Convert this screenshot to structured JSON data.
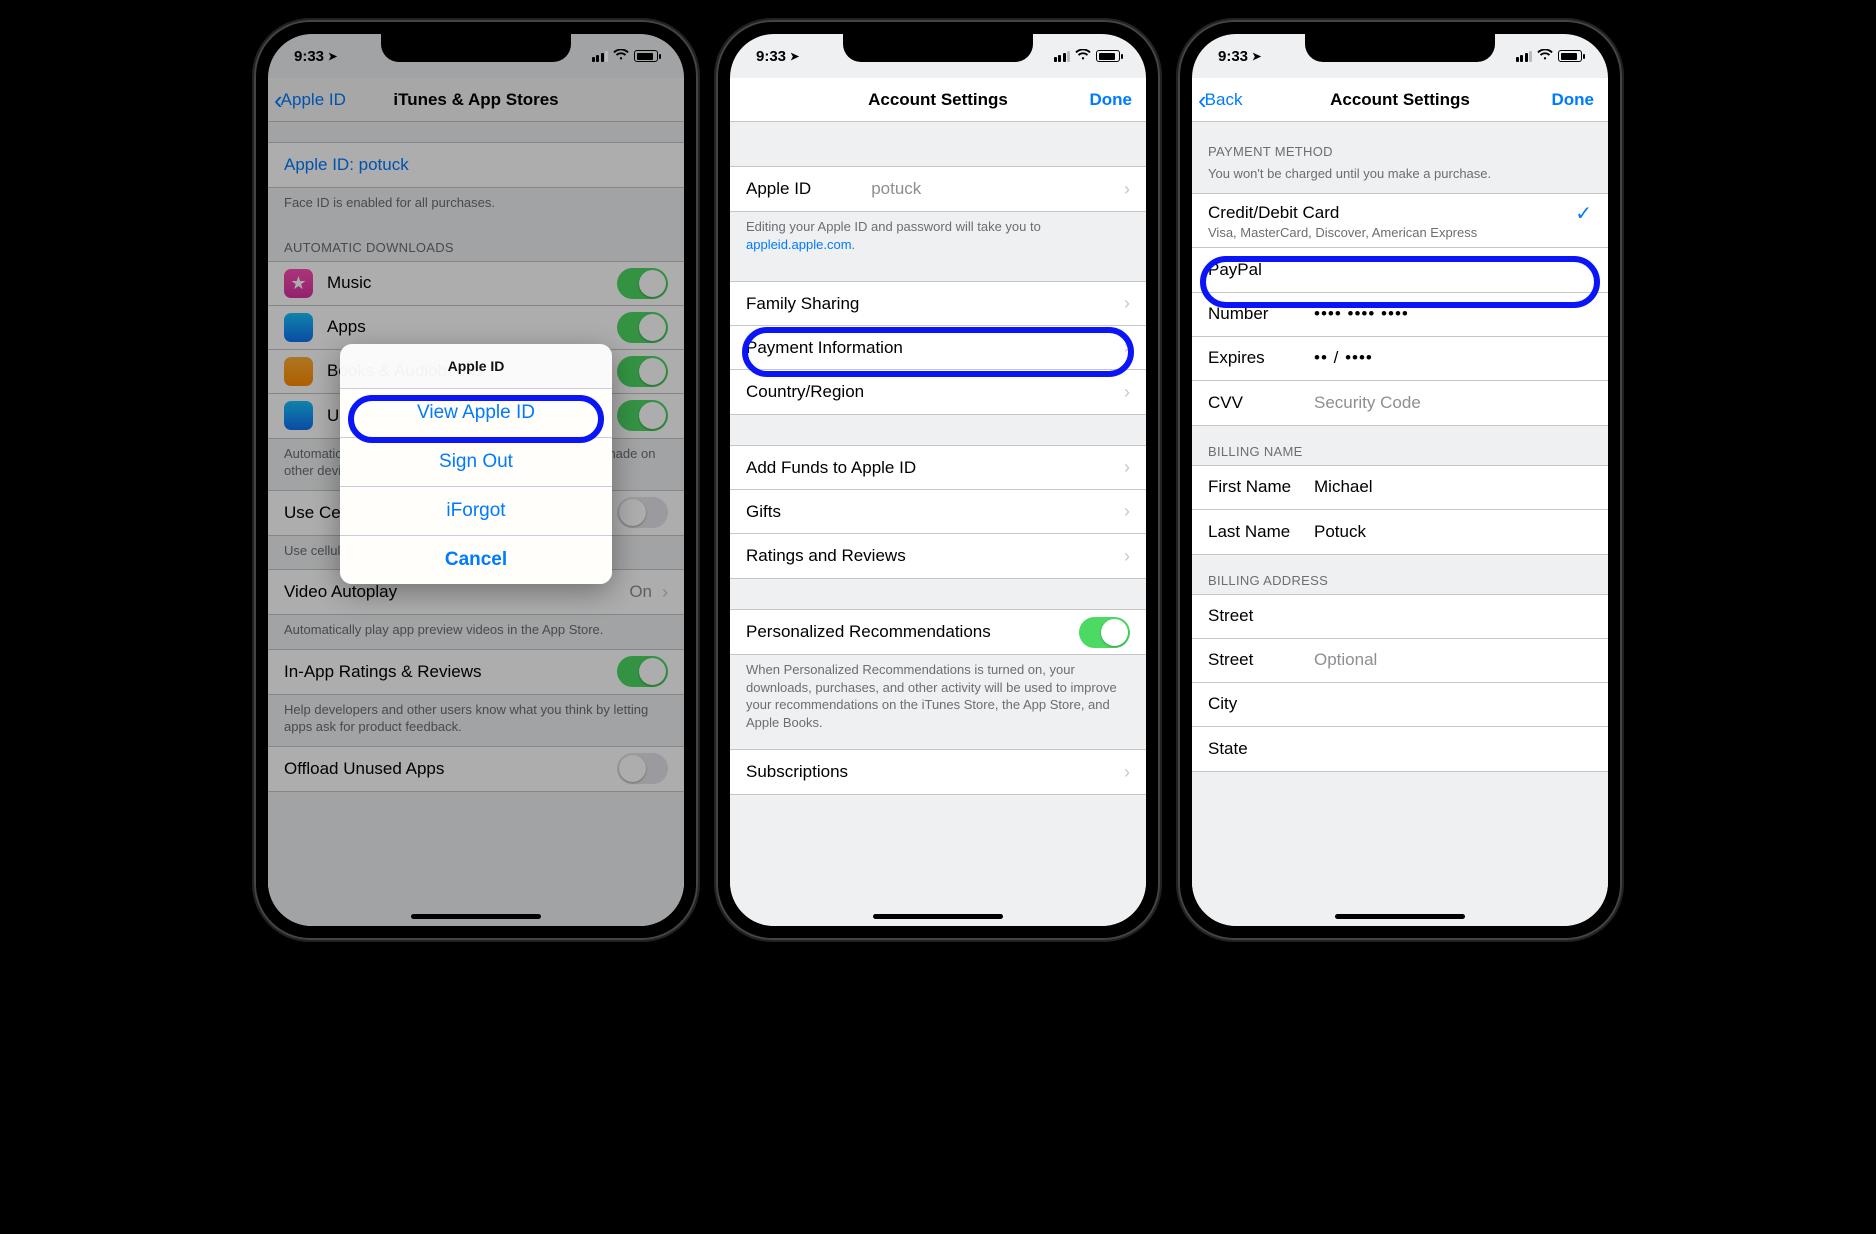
{
  "status": {
    "time": "9:33",
    "loc_icon": "◤"
  },
  "phone1": {
    "nav_back": "Apple ID",
    "nav_title": "iTunes & App Stores",
    "apple_id_row": "Apple ID: potuck",
    "faceid_footer": "Face ID is enabled for all purchases.",
    "section_auto": "AUTOMATIC DOWNLOADS",
    "rows_auto": {
      "music": "Music",
      "apps": "Apps",
      "books": "Books & Audiobooks",
      "updates": "Updates"
    },
    "auto_footer": "Automatically download new purchases (including free) made on other devices.",
    "cellular_row": "Use Cellular Data",
    "cellular_footer": "Use cellular network for automatic downloads.",
    "video_row": "Video Autoplay",
    "video_value": "On",
    "video_footer": "Automatically play app preview videos in the App Store.",
    "inapp_row": "In-App Ratings & Reviews",
    "inapp_footer": "Help developers and other users know what you think by letting apps ask for product feedback.",
    "offload_row": "Offload Unused Apps",
    "sheet": {
      "title": "Apple ID",
      "view": "View Apple ID",
      "signout": "Sign Out",
      "iforgot": "iForgot",
      "cancel": "Cancel"
    }
  },
  "phone2": {
    "nav_title": "Account Settings",
    "nav_done": "Done",
    "appleid_label": "Apple ID",
    "appleid_value": "potuck",
    "appleid_footer_pre": "Editing your Apple ID and password will take you to ",
    "appleid_footer_link": "appleid.apple.com",
    "rows1": {
      "family": "Family Sharing",
      "payment": "Payment Information",
      "country": "Country/Region"
    },
    "rows2": {
      "addfunds": "Add Funds to Apple ID",
      "gifts": "Gifts",
      "ratings": "Ratings and Reviews"
    },
    "personal": "Personalized Recommendations",
    "personal_footer": "When Personalized Recommendations is turned on, your downloads, purchases, and other activity will be used to improve your recommendations on the iTunes Store, the App Store, and Apple Books.",
    "subs": "Subscriptions"
  },
  "phone3": {
    "nav_back": "Back",
    "nav_title": "Account Settings",
    "nav_done": "Done",
    "section_pm": "PAYMENT METHOD",
    "pm_footer": "You won't be charged until you make a purchase.",
    "credit_label": "Credit/Debit Card",
    "credit_sub": "Visa, MasterCard, Discover, American Express",
    "paypal": "PayPal",
    "number_label": "Number",
    "number_value": "•••• •••• ••••",
    "expires_label": "Expires",
    "expires_value": "••   /   ••••",
    "cvv_label": "CVV",
    "cvv_placeholder": "Security Code",
    "section_bn": "BILLING NAME",
    "fn_label": "First Name",
    "fn_value": "Michael",
    "ln_label": "Last Name",
    "ln_value": "Potuck",
    "section_ba": "BILLING ADDRESS",
    "street": "Street",
    "street2_label": "Street",
    "street2_ph": "Optional",
    "city": "City",
    "state": "State"
  }
}
